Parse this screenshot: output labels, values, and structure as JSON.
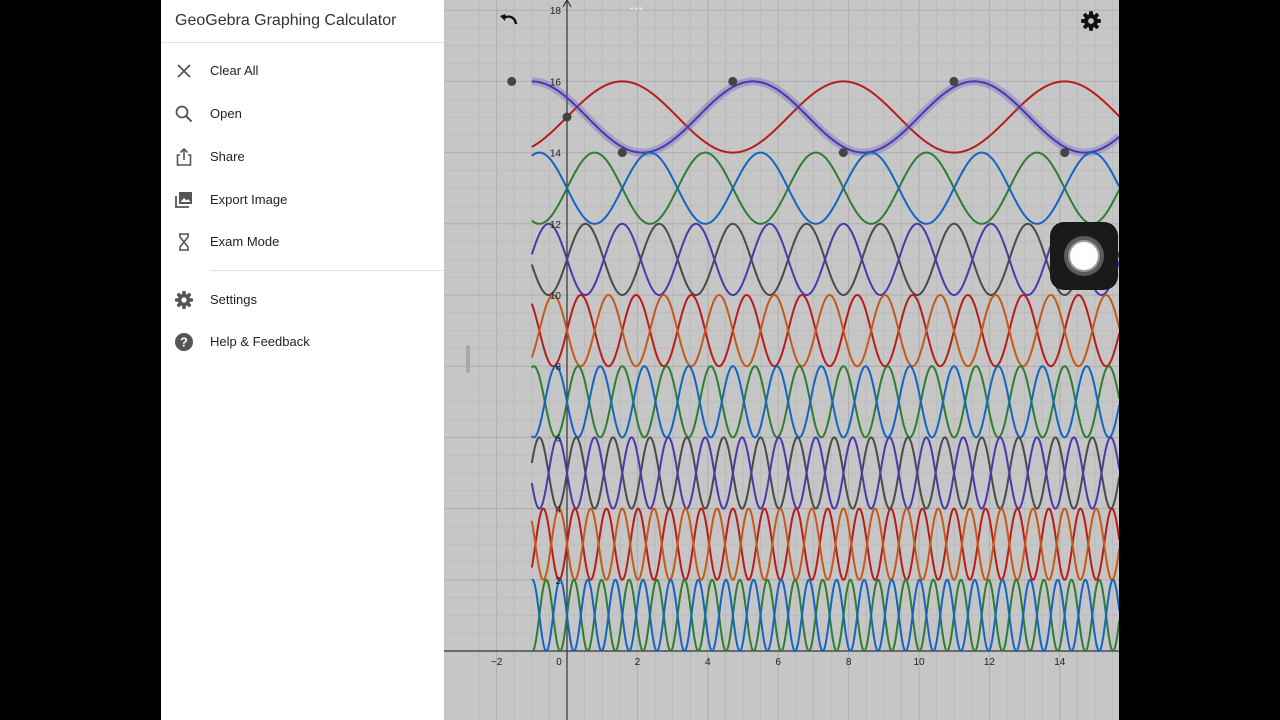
{
  "app": {
    "title": "GeoGebra Graphing Calculator"
  },
  "menu": {
    "items": [
      {
        "label": "Clear All",
        "icon": "close-icon"
      },
      {
        "label": "Open",
        "icon": "search-icon"
      },
      {
        "label": "Share",
        "icon": "share-icon"
      },
      {
        "label": "Export Image",
        "icon": "image-icon"
      },
      {
        "label": "Exam Mode",
        "icon": "hourglass-icon"
      },
      {
        "label": "Settings",
        "icon": "gear-icon"
      },
      {
        "label": "Help & Feedback",
        "icon": "help-icon"
      }
    ]
  },
  "graph": {
    "x_ticks": [
      "−2",
      "0",
      "2",
      "4",
      "6",
      "8",
      "10",
      "12",
      "14"
    ],
    "y_ticks": [
      "18",
      "16",
      "14",
      "12",
      "10",
      "8",
      "6",
      "4",
      "2"
    ],
    "colors": {
      "blue": "#1565c0",
      "red": "#b71c1c",
      "green": "#2e7d32",
      "purple": "#4a3aa8",
      "gray": "#4a4a4a",
      "orange": "#c25a1a",
      "highlight": "#6a5acd",
      "point": "#444444"
    }
  },
  "chart_data": {
    "type": "line",
    "xlim": [
      -2.5,
      15.6
    ],
    "ylim": [
      0,
      18
    ],
    "grid": true,
    "series": [
      {
        "color": "red",
        "x": [
          -2.5,
          15.6
        ],
        "function": "15 + sin(x)",
        "amplitude": 1,
        "center": 15,
        "frequency": 1
      },
      {
        "color": "purple",
        "x": [
          -2.5,
          15.6
        ],
        "function": "15 + cos(x + 1)",
        "amplitude": 1,
        "center": 15,
        "frequency": 1,
        "highlighted": true
      },
      {
        "color": "green",
        "x": [
          -2.5,
          15.6
        ],
        "function": "13 + sin(2x)",
        "amplitude": 1,
        "center": 13,
        "frequency": 2
      },
      {
        "color": "blue",
        "x": [
          -2.5,
          15.6
        ],
        "function": "13 − sin(2x)",
        "amplitude": 1,
        "center": 13,
        "frequency": 2
      },
      {
        "color": "gray",
        "x": [
          -2.5,
          15.6
        ],
        "function": "11 + sin(3x)",
        "amplitude": 1,
        "center": 11,
        "frequency": 3
      },
      {
        "color": "purple",
        "x": [
          -2.5,
          15.6
        ],
        "function": "11 − sin(3x)",
        "amplitude": 1,
        "center": 11,
        "frequency": 3
      },
      {
        "color": "red",
        "x": [
          -2.5,
          15.6
        ],
        "function": "9 + sin(4x)",
        "amplitude": 1,
        "center": 9,
        "frequency": 4
      },
      {
        "color": "orange",
        "x": [
          -2.5,
          15.6
        ],
        "function": "9 − sin(4x)",
        "amplitude": 1,
        "center": 9,
        "frequency": 4
      },
      {
        "color": "green",
        "x": [
          -2.5,
          15.6
        ],
        "function": "7 + sin(5x)",
        "amplitude": 1,
        "center": 7,
        "frequency": 5
      },
      {
        "color": "blue",
        "x": [
          -2.5,
          15.6
        ],
        "function": "7 − sin(5x)",
        "amplitude": 1,
        "center": 7,
        "frequency": 5
      },
      {
        "color": "gray",
        "x": [
          -2.5,
          15.6
        ],
        "function": "5 + sin(6x)",
        "amplitude": 1,
        "center": 5,
        "frequency": 6
      },
      {
        "color": "purple",
        "x": [
          -2.5,
          15.6
        ],
        "function": "5 − sin(6x)",
        "amplitude": 1,
        "center": 5,
        "frequency": 6
      },
      {
        "color": "red",
        "x": [
          -2.5,
          15.6
        ],
        "function": "3 + sin(7x)",
        "amplitude": 1,
        "center": 3,
        "frequency": 7
      },
      {
        "color": "orange",
        "x": [
          -2.5,
          15.6
        ],
        "function": "3 − sin(7x)",
        "amplitude": 1,
        "center": 3,
        "frequency": 7
      },
      {
        "color": "green",
        "x": [
          -2.5,
          15.6
        ],
        "function": "1 + sin(8x)",
        "amplitude": 1,
        "center": 1,
        "frequency": 8
      },
      {
        "color": "blue",
        "x": [
          -2.5,
          15.6
        ],
        "function": "1 − sin(8x)",
        "amplitude": 1,
        "center": 1,
        "frequency": 8
      }
    ],
    "points": [
      {
        "x": -1.57,
        "y": 16
      },
      {
        "x": 0,
        "y": 15
      },
      {
        "x": 1.57,
        "y": 14
      },
      {
        "x": 4.71,
        "y": 16
      },
      {
        "x": 7.85,
        "y": 14
      },
      {
        "x": 10.99,
        "y": 16
      },
      {
        "x": 14.14,
        "y": 14
      }
    ]
  }
}
